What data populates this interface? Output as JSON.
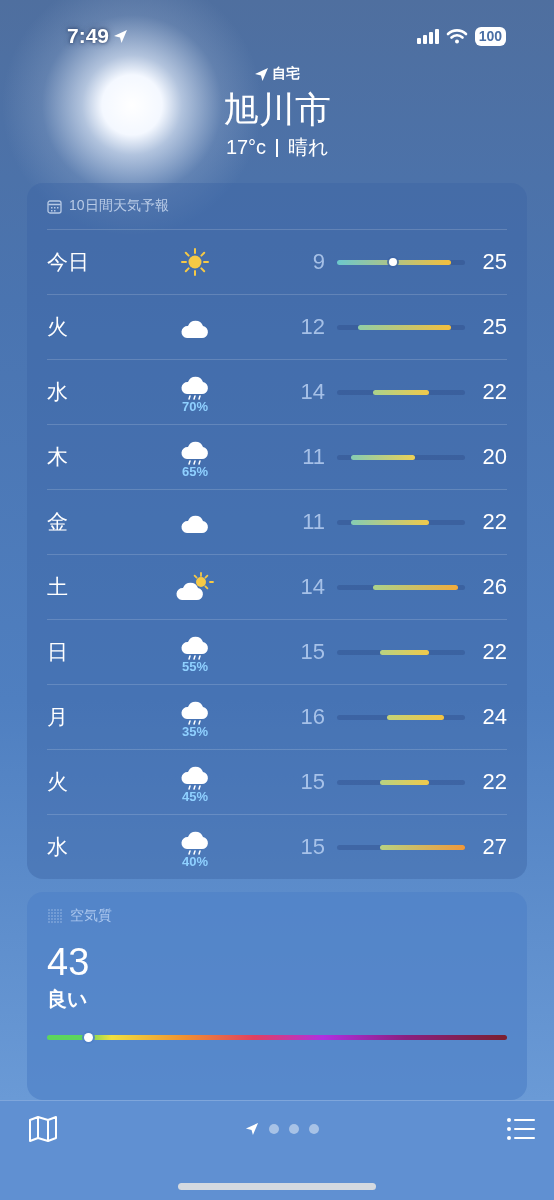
{
  "status_bar": {
    "time": "7:49",
    "battery": "100"
  },
  "location": {
    "label": "自宅",
    "city": "旭川市",
    "temperature": "17°c",
    "condition": "晴れ"
  },
  "forecast": {
    "title": "10日間天気予報",
    "days": [
      {
        "day": "今日",
        "kind": "sun",
        "low": "9",
        "high": "25",
        "level": 0.44
      },
      {
        "day": "火",
        "kind": "cloud",
        "low": "12",
        "high": "25"
      },
      {
        "day": "水",
        "kind": "rain",
        "precip": "70%",
        "low": "14",
        "high": "22"
      },
      {
        "day": "木",
        "kind": "rain",
        "precip": "65%",
        "low": "11",
        "high": "20"
      },
      {
        "day": "金",
        "kind": "cloud",
        "low": "11",
        "high": "22"
      },
      {
        "day": "土",
        "kind": "partly",
        "low": "14",
        "high": "26"
      },
      {
        "day": "日",
        "kind": "rain",
        "precip": "55%",
        "low": "15",
        "high": "22"
      },
      {
        "day": "月",
        "kind": "rain",
        "precip": "35%",
        "low": "16",
        "high": "24"
      },
      {
        "day": "火",
        "kind": "rain",
        "precip": "45%",
        "low": "15",
        "high": "22"
      },
      {
        "day": "水",
        "kind": "rain",
        "precip": "40%",
        "low": "15",
        "high": "27"
      }
    ]
  },
  "air_quality": {
    "title": "空気質",
    "value": "43",
    "rating": "良い",
    "level": 0.09
  },
  "pages": [
    {
      "kind": "location",
      "selected": true
    },
    {
      "kind": "dot",
      "selected": false
    },
    {
      "kind": "dot",
      "selected": false
    },
    {
      "kind": "dot",
      "selected": false
    }
  ]
}
